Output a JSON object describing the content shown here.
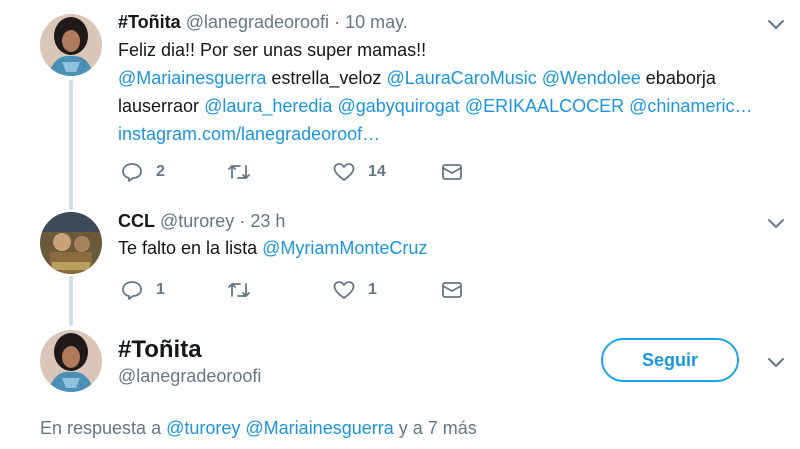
{
  "tweet1": {
    "name": "#Toñita",
    "handle": "@lanegradeoroofi",
    "sep": "·",
    "time": "10 may.",
    "line1": "Feliz dia!! Por ser unas super mamas!!",
    "line2": {
      "m1": "@Mariainesguerra",
      "t1": "estrella_veloz",
      "m2": "@LauraCaroMusic",
      "m3": "@Wendolee",
      "t2": "ebaborja"
    },
    "line3": {
      "t1": "lauserraor",
      "m1": "@laura_heredia",
      "m2": "@gabyquirogat",
      "m3": "@ERIKAALCOCER",
      "m4": "@chinameric…"
    },
    "link": "instagram.com/lanegradeoroof…",
    "replies": "2",
    "likes": "14"
  },
  "tweet2": {
    "name": "CCL",
    "handle": "@turorey",
    "sep": "·",
    "time": "23 h",
    "text": "Te falto en la lista",
    "mention": "@MyriamMonteCruz",
    "replies": "1",
    "likes": "1"
  },
  "main": {
    "name": "#Toñita",
    "handle": "@lanegradeoroofi",
    "follow_label": "Seguir"
  },
  "reply_context": {
    "prefix": "En respuesta a",
    "m1": "@turorey",
    "m2": "@Mariainesguerra",
    "suffix": "y a 7 más"
  },
  "icons": {
    "reply": "reply-icon",
    "retweet": "retweet-icon",
    "like": "heart-icon",
    "dm": "envelope-icon",
    "chevron": "chevron-down-icon"
  },
  "colors": {
    "accent": "#1b95e0",
    "muted": "#657786",
    "thread": "#cfe0ea"
  }
}
